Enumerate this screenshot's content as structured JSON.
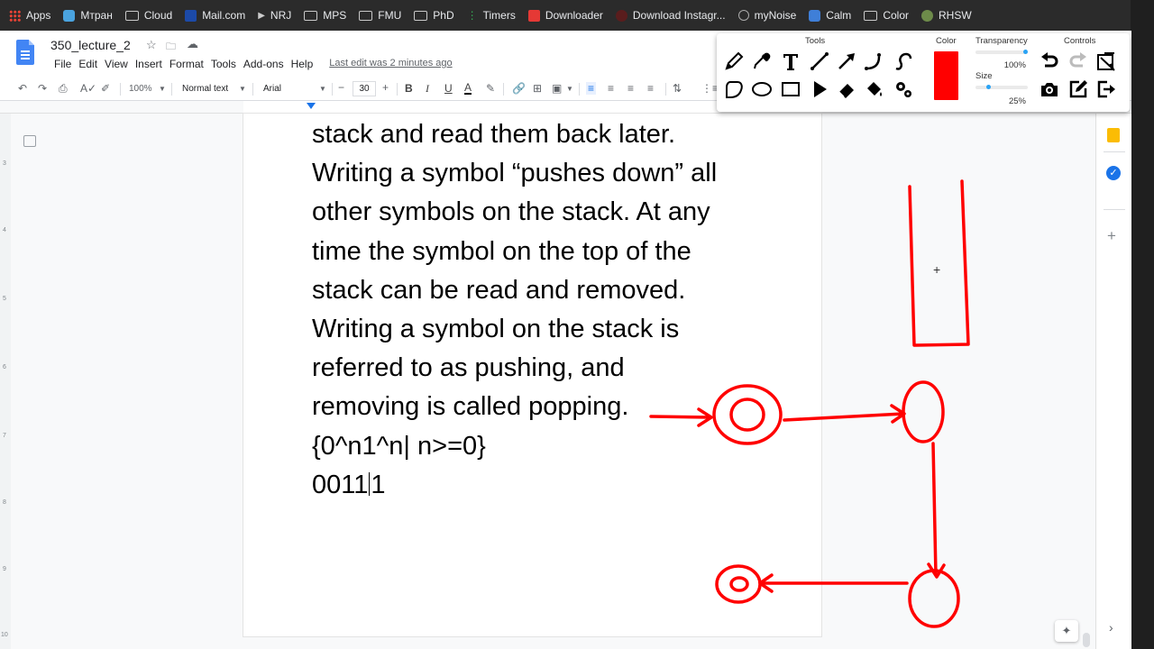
{
  "bookmarks": [
    {
      "label": "Apps",
      "icon": "apps-grid-icon"
    },
    {
      "label": "Мтран",
      "icon": "mtran-icon"
    },
    {
      "label": "Cloud",
      "icon": "folder-icon"
    },
    {
      "label": "Mail.com",
      "icon": "mail-icon"
    },
    {
      "label": "NRJ",
      "icon": "play-icon"
    },
    {
      "label": "MPS",
      "icon": "folder-icon"
    },
    {
      "label": "FMU",
      "icon": "folder-icon"
    },
    {
      "label": "PhD",
      "icon": "folder-icon"
    },
    {
      "label": "Timers",
      "icon": "timers-icon"
    },
    {
      "label": "Downloader",
      "icon": "download-icon"
    },
    {
      "label": "Download Instagr...",
      "icon": "instagram-icon"
    },
    {
      "label": "myNoise",
      "icon": "mynoise-icon"
    },
    {
      "label": "Calm",
      "icon": "calm-icon"
    },
    {
      "label": "Color",
      "icon": "folder-icon"
    },
    {
      "label": "RHSW",
      "icon": "rhsw-icon"
    }
  ],
  "doc": {
    "title": "350_lecture_2",
    "last_edit": "Last edit was 2 minutes ago"
  },
  "menu": [
    "File",
    "Edit",
    "View",
    "Insert",
    "Format",
    "Tools",
    "Add-ons",
    "Help"
  ],
  "toolbar": {
    "zoom": "100%",
    "style": "Normal text",
    "font": "Arial",
    "font_size": "30",
    "minus": "−",
    "plus": "+"
  },
  "vruler_numbers": [
    "3",
    "4",
    "5",
    "6",
    "7",
    "8",
    "9",
    "10"
  ],
  "content": {
    "lines": [
      "stack and read them back later.",
      "Writing a symbol “pushes down” all",
      "other symbols on the stack. At any",
      "time the symbol on the top of the",
      "stack can be read and removed.",
      "Writing a symbol on the stack is",
      "referred to as pushing, and",
      "removing is called popping.",
      "{0^n1^n| n>=0}"
    ],
    "input_before_caret": "0011",
    "input_after_caret": "1"
  },
  "palette": {
    "tools_heading": "Tools",
    "color_heading": "Color",
    "transparency_heading": "Transparency",
    "controls_heading": "Controls",
    "transparency_value": "100%",
    "size_label": "Size",
    "size_value": "25%",
    "selected_color": "#ff0000",
    "tools": [
      "pencil-icon",
      "eyedropper-icon",
      "text-tool-icon",
      "line-icon",
      "arrow-icon",
      "curve-icon",
      "freehand-s-icon",
      "lasso-icon",
      "ellipse-icon",
      "rectangle-icon",
      "pointer-icon",
      "eraser-icon",
      "fill-bucket-icon",
      "settings-icon"
    ],
    "controls": [
      "undo-icon",
      "redo-icon",
      "clear-icon",
      "camera-icon",
      "edit-icon",
      "exit-icon"
    ]
  },
  "colors": {
    "annotation": "#ff0000",
    "accent": "#1a73e8",
    "bookmarks_bg": "#2b2b2b"
  }
}
